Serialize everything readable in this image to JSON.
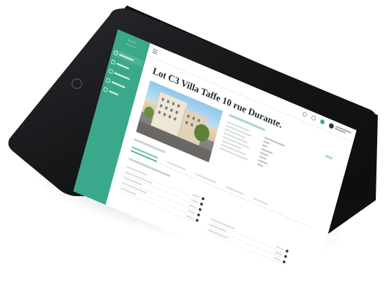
{
  "page": {
    "heading": "Lot C3 Villa Taffe 10 rue Durante."
  },
  "colors": {
    "accent": "#3aa88a",
    "tablet_frame": "#1c1d1f",
    "background": "#ffffff"
  },
  "icons": [
    "menu-icon",
    "bell-icon",
    "message-icon",
    "phone-icon",
    "user-avatar"
  ]
}
